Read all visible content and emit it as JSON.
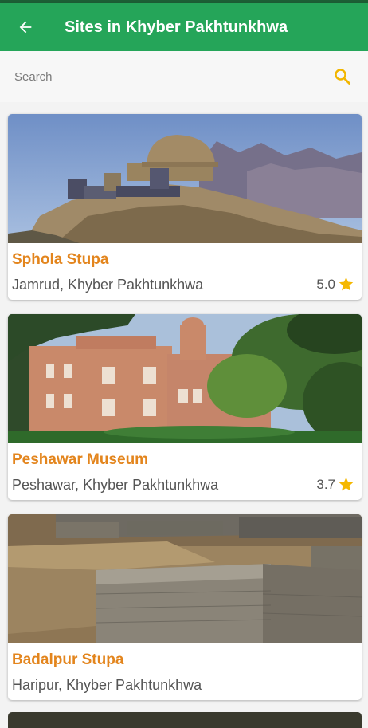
{
  "appbar": {
    "title": "Sites in Khyber Pakhtunkhwa",
    "back_icon": "arrow-back-icon"
  },
  "search": {
    "placeholder": "Search",
    "value": "",
    "icon": "search-icon",
    "icon_color": "#f2b600"
  },
  "colors": {
    "primary": "#25a559",
    "status_bar": "#1c5f35",
    "title_orange": "#e3851d",
    "star": "#f5b800"
  },
  "sites": [
    {
      "name": "Sphola Stupa",
      "location": "Jamrud, Khyber Pakhtunkhwa",
      "rating": "5.0"
    },
    {
      "name": "Peshawar Museum",
      "location": "Peshawar, Khyber Pakhtunkhwa",
      "rating": "3.7"
    },
    {
      "name": "Badalpur Stupa",
      "location": "Haripur, Khyber Pakhtunkhwa",
      "rating": ""
    }
  ]
}
